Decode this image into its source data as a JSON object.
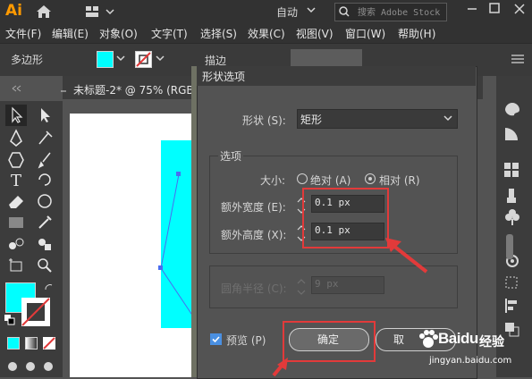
{
  "app": {
    "logo": "Ai",
    "workspace": "自动",
    "search_placeholder": "搜索 Adobe Stock"
  },
  "menu": [
    "文件(F)",
    "编辑(E)",
    "对象(O)",
    "文字(T)",
    "选择(S)",
    "效果(C)",
    "视图(V)",
    "窗口(W)",
    "帮助(H)"
  ],
  "control_bar": {
    "tool_name": "多边形",
    "fill_color": "#00ffff",
    "stroke_label": "描边"
  },
  "document": {
    "tab_label": "未标题-2* @ 75% (RGB"
  },
  "dialog": {
    "title": "形状选项",
    "shape_label": "形状 (S):",
    "shape_value": "矩形",
    "options_title": "选项",
    "size_label": "大小:",
    "size_absolute": "绝对 (A)",
    "size_relative": "相对 (R)",
    "size_selected": "relative",
    "extra_width_label": "额外宽度 (E):",
    "extra_width_value": "0.1 px",
    "extra_height_label": "额外高度 (X):",
    "extra_height_value": "0.1 px",
    "corner_radius_label": "圆角半径 (C):",
    "corner_radius_value": "9 px",
    "preview_label": "预览 (P)",
    "preview_checked": true,
    "ok_label": "确定",
    "cancel_label": "取"
  },
  "colors": {
    "highlight": "#e23a3a",
    "accent_cyan": "#00ffff"
  },
  "watermark": {
    "logo": "Baidu",
    "text": "经验",
    "url": "jingyan.baidu.com"
  }
}
